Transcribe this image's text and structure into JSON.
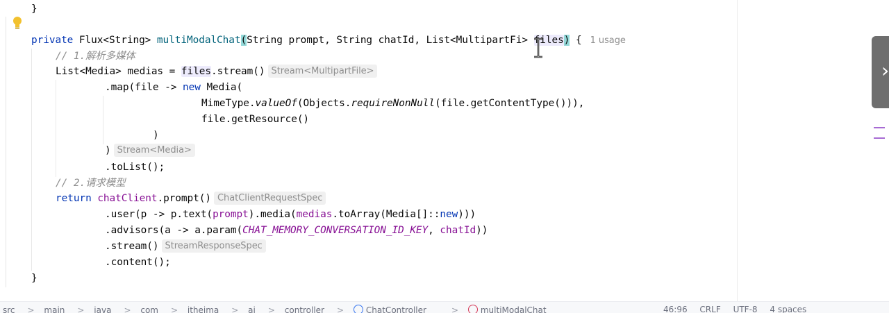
{
  "code": {
    "prev_brace": "}",
    "method_sig": {
      "kw_private": "private",
      "return_type": " Flux<String> ",
      "method_name": "multiModalChat",
      "open_paren": "(",
      "params_a": "String prompt, String chatId, List<MultipartFi",
      "params_b": "> ",
      "param_files": "files",
      "close_paren": ")",
      "tail": " {",
      "usage_hint": "1 usage"
    },
    "comment_1": "// 1.解析多媒体",
    "line_medias": {
      "decl": "List<Media> medias = ",
      "files": "files",
      "stream": ".stream()",
      "hint": "Stream<MultipartFile>"
    },
    "line_map": {
      "pre": ".map(file -> ",
      "kw_new": "new",
      "post": " Media("
    },
    "line_mime": {
      "a": "MimeType.",
      "valueof": "valueOf",
      "b": "(Objects.",
      "require": "requireNonNull",
      "c": "(file.getContentType())),"
    },
    "line_resource": "file.getResource()",
    "line_close_paren_1": ")",
    "line_close_paren_2": {
      "text": ")",
      "hint": "Stream<Media>"
    },
    "line_tolist": ".toList();",
    "comment_2": "// 2.请求模型",
    "line_return": {
      "kw": "return",
      "field": "chatClient",
      "call": ".prompt()",
      "hint": "ChatClientRequestSpec"
    },
    "line_user": {
      "a": ".user(p -> p.text(",
      "prompt": "prompt",
      "b": ").media(",
      "medias": "medias",
      "c": ".toArray(Media[]::",
      "kw_new": "new",
      "d": ")))"
    },
    "line_advisors": {
      "a": ".advisors(a -> a.param(",
      "key": "CHAT_MEMORY_CONVERSATION_ID_KEY",
      "b": ", ",
      "chatid": "chatId",
      "c": "))"
    },
    "line_stream": {
      "text": ".stream()",
      "hint": "StreamResponseSpec"
    },
    "line_content": ".content();",
    "end_brace": "}"
  },
  "statusbar": {
    "breadcrumbs": [
      "src",
      "main",
      "java",
      "com",
      "itheima",
      "ai",
      "controller",
      "ChatController",
      "multiModalChat"
    ],
    "separator": ">",
    "position": "46:96",
    "line_sep": "CRLF",
    "encoding": "UTF-8",
    "indent": "4 spaces"
  },
  "colors": {
    "keyword": "#0033b3",
    "method_decl": "#00627a",
    "comment": "#8c8c8c",
    "field": "#871094",
    "bracket_match": "#93d9d9"
  },
  "icons": {
    "gutter": "lightbulb-icon",
    "mouse": "text-cursor-icon"
  }
}
